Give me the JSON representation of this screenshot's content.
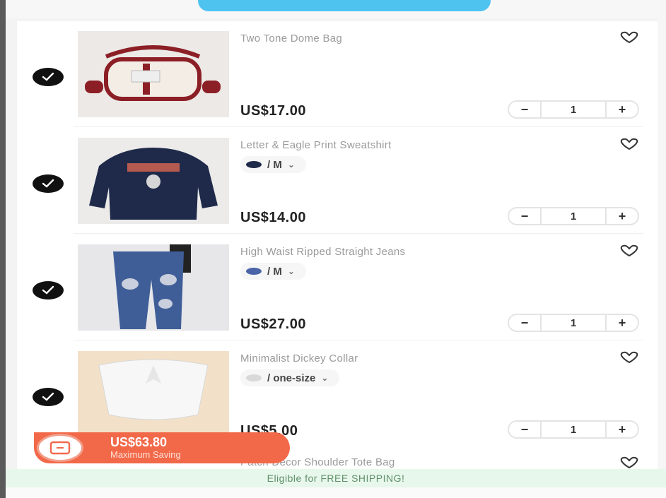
{
  "cart": {
    "items": [
      {
        "title": "Two Tone Dome Bag",
        "variant": null,
        "price": "US$17.00",
        "qty": "1",
        "selected": true,
        "image": "two-tone-dome-bag"
      },
      {
        "title": "Letter & Eagle Print Sweatshirt",
        "variant": {
          "size": "/ M",
          "swatch_color": "#1f2a4a"
        },
        "price": "US$14.00",
        "qty": "1",
        "selected": true,
        "image": "navy-sweatshirt"
      },
      {
        "title": "High Waist Ripped Straight Jeans",
        "variant": {
          "size": "/ M",
          "swatch_color": "#4a64a8"
        },
        "price": "US$27.00",
        "qty": "1",
        "selected": true,
        "image": "ripped-jeans"
      },
      {
        "title": "Minimalist Dickey Collar",
        "variant": {
          "size": "/ one-size",
          "swatch_color": "#d9d9d9"
        },
        "price": "US$5.00",
        "qty": "1",
        "selected": true,
        "image": "dickey-collar"
      }
    ],
    "partial_item": {
      "title": "Patch Decor Shoulder Tote Bag"
    }
  },
  "stepper": {
    "minus": "−",
    "plus": "+"
  },
  "variant_chevron": "⌄",
  "saving_badge": {
    "amount": "US$63.80",
    "label": "Maximum Saving"
  },
  "shipping_banner": {
    "text": "Eligible for FREE SHIPPING!"
  },
  "colors": {
    "accent": "#f2694a",
    "top_pill": "#4ec3f0",
    "shipping_bg": "#e8f7ec",
    "check": "#111111"
  },
  "icons": {
    "check": "check-icon",
    "heart": "heart-icon",
    "coupon": "coupon-icon",
    "chevron": "chevron-down-icon"
  }
}
